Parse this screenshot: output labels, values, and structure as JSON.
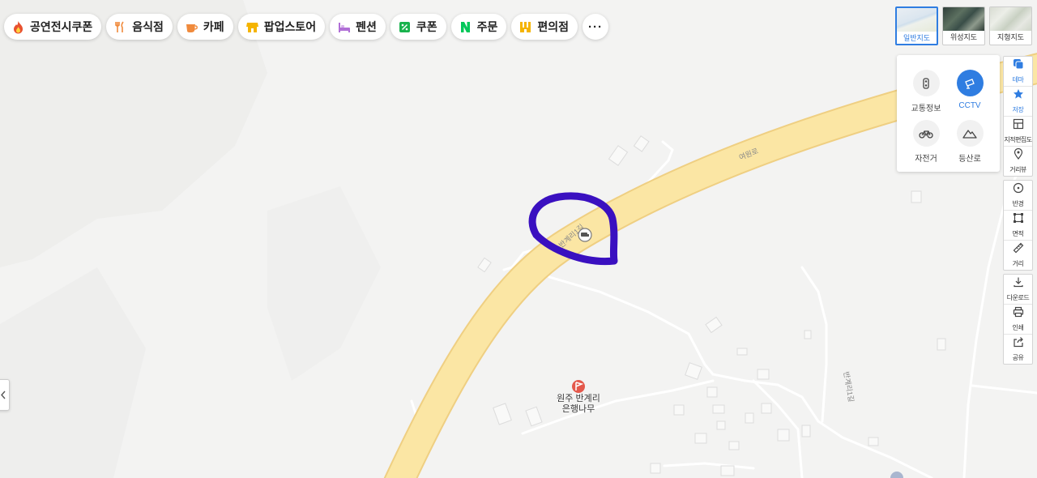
{
  "chips": [
    {
      "label": "공연전시쿠폰",
      "icon": "fire-icon",
      "color": "#e8512f"
    },
    {
      "label": "음식점",
      "icon": "fork-knife-icon",
      "color": "#f08a3c"
    },
    {
      "label": "카페",
      "icon": "cup-icon",
      "color": "#f08a3c"
    },
    {
      "label": "팝업스토어",
      "icon": "store-icon",
      "color": "#f5b400"
    },
    {
      "label": "펜션",
      "icon": "bed-icon",
      "color": "#b06fd6"
    },
    {
      "label": "쿠폰",
      "icon": "coupon-icon",
      "color": "#19b34d"
    },
    {
      "label": "주문",
      "icon": "naver-n-icon",
      "color": "#03c75a"
    },
    {
      "label": "편의점",
      "icon": "convenience-store-icon",
      "color": "#f5b400"
    }
  ],
  "more_label": "···",
  "map_types": [
    {
      "label": "일반지도",
      "active": true
    },
    {
      "label": "위성지도",
      "active": false
    },
    {
      "label": "지형지도",
      "active": false
    }
  ],
  "layers": [
    {
      "label": "교통정보",
      "icon": "traffic-light-icon",
      "on": false
    },
    {
      "label": "CCTV",
      "icon": "cctv-icon",
      "on": true
    },
    {
      "label": "자전거",
      "icon": "bicycle-icon",
      "on": false
    },
    {
      "label": "등산로",
      "icon": "mountain-icon",
      "on": false
    }
  ],
  "tools_group1": [
    {
      "label": "테마",
      "icon": "theme-icon",
      "blue": true
    },
    {
      "label": "저장",
      "icon": "star-icon",
      "blue": true
    },
    {
      "label": "지적편집도",
      "icon": "cadastral-map-icon",
      "blue": false
    },
    {
      "label": "거리뷰",
      "icon": "street-view-pin-icon",
      "blue": false
    }
  ],
  "tools_group2": [
    {
      "label": "반경",
      "icon": "radius-icon"
    },
    {
      "label": "면적",
      "icon": "area-icon"
    },
    {
      "label": "거리",
      "icon": "ruler-icon"
    }
  ],
  "tools_group3": [
    {
      "label": "다운로드",
      "icon": "download-icon"
    },
    {
      "label": "인쇄",
      "icon": "print-icon"
    },
    {
      "label": "공유",
      "icon": "share-icon"
    }
  ],
  "road_labels": {
    "main": "여원로",
    "side1": "반계리1길",
    "side2": "반계리1길"
  },
  "poi": {
    "name_line1": "원주 반계리",
    "name_line2": "은행나무",
    "icon": "flag-pin-icon",
    "color": "#e4584b"
  },
  "colors": {
    "road": "#fbe6a4",
    "road_edge": "#efcf82",
    "annotation": "#3a10c0",
    "accent": "#2f7de1"
  }
}
